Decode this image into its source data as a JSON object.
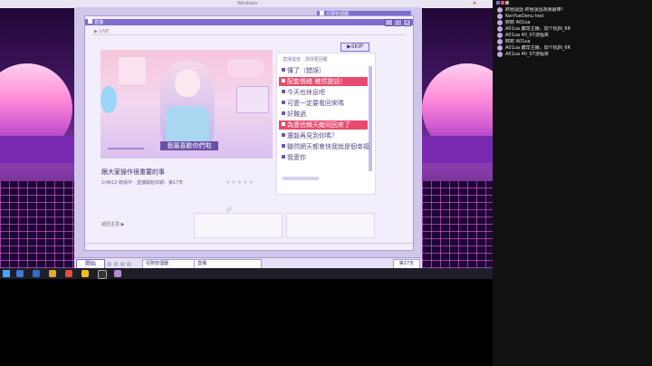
{
  "desktop": {
    "top_bar_title": "Windows",
    "game": {
      "window_title": "直播",
      "secondary_window_title": "任務管理器",
      "stream_tab": "LIVE",
      "skip_label": "SKIP",
      "prompt": "直播進度 · 選擇要回覆",
      "choices": [
        {
          "label": "懂了（錯誤）",
          "selected": false
        },
        {
          "label": "配套情緒 確然提話！",
          "selected": true
        },
        {
          "label": "今天也休息吧",
          "selected": false
        },
        {
          "label": "可愛一定要看回來嗎",
          "selected": false
        },
        {
          "label": "好難過",
          "selected": false
        },
        {
          "label": "為愛信賴天敵同回來了",
          "selected": true
        },
        {
          "label": "還能再見到你嗎？",
          "selected": false
        },
        {
          "label": "雖然網天都會快我就是個幸福",
          "selected": false
        },
        {
          "label": "我愛你",
          "selected": false
        }
      ],
      "stream_caption": "我最喜歡你們啦",
      "stream_title": "跟大家操作很重要的事",
      "stream_meta": "1/4612 欸看中 · 直播開始日期：第17天",
      "back_link": "返回主頁 ▶",
      "day_label": "第17天"
    },
    "inner_taskbar": {
      "start": "開始",
      "items": [
        "任務管理器",
        "直播"
      ]
    }
  },
  "chat": {
    "messages": [
      {
        "user": "",
        "text": "終極說話 終極說話為我最棒！"
      },
      {
        "user": "",
        "text": "KenYueDenu test"
      },
      {
        "user": "",
        "text": "欸欸 A01ua"
      },
      {
        "user": "",
        "text": "A01ua 聽眾主播，加个机JN_6R"
      },
      {
        "user": "",
        "text": "A01ua 40_07流程來"
      },
      {
        "user": "",
        "text": "欸欸 A01ua"
      },
      {
        "user": "",
        "text": "A01ua 聽眾主播，加个机JN_6R"
      },
      {
        "user": "",
        "text": "A01ua 40_07流程來"
      }
    ]
  },
  "colors": {
    "accent": "#7d6ed0",
    "selected_choice": "#e84a6d",
    "desktop_purple": "#3a0f55"
  }
}
